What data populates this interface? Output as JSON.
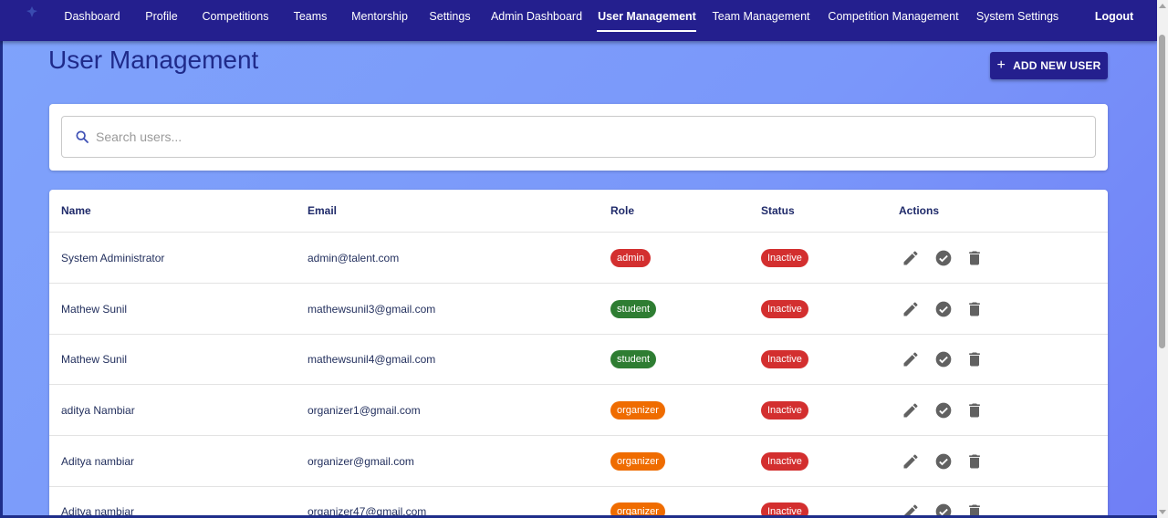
{
  "nav": {
    "items": [
      {
        "label": "Dashboard"
      },
      {
        "label": "Profile"
      },
      {
        "label": "Competitions"
      },
      {
        "label": "Teams"
      },
      {
        "label": "Mentorship"
      },
      {
        "label": "Settings"
      },
      {
        "label": "Admin Dashboard"
      },
      {
        "label": "User Management",
        "active": true
      },
      {
        "label": "Team Management"
      },
      {
        "label": "Competition Management"
      },
      {
        "label": "System Settings"
      },
      {
        "label": "Logout"
      }
    ]
  },
  "page": {
    "title": "User Management",
    "add_button_label": "ADD NEW USER"
  },
  "search": {
    "placeholder": "Search users...",
    "value": ""
  },
  "table": {
    "headers": {
      "name": "Name",
      "email": "Email",
      "role": "Role",
      "status": "Status",
      "actions": "Actions"
    },
    "rows": [
      {
        "name": "System Administrator",
        "email": "admin@talent.com",
        "role": "admin",
        "status": "Inactive"
      },
      {
        "name": "Mathew Sunil",
        "email": "mathewsunil3@gmail.com",
        "role": "student",
        "status": "Inactive"
      },
      {
        "name": "Mathew Sunil",
        "email": "mathewsunil4@gmail.com",
        "role": "student",
        "status": "Inactive"
      },
      {
        "name": "aditya Nambiar",
        "email": "organizer1@gmail.com",
        "role": "organizer",
        "status": "Inactive"
      },
      {
        "name": "Aditya nambiar",
        "email": "organizer@gmail.com",
        "role": "organizer",
        "status": "Inactive"
      },
      {
        "name": "Aditya nambiar",
        "email": "organizer47@gmail.com",
        "role": "organizer",
        "status": "Inactive"
      }
    ],
    "action_icons": [
      "edit-icon",
      "check-circle-icon",
      "delete-icon"
    ]
  },
  "colors": {
    "nav_bg": "#241f8e",
    "title": "#1f2a8a",
    "admin": "#d32f2f",
    "student": "#2e7d32",
    "organizer": "#ef6c00",
    "inactive": "#d32f2f"
  }
}
